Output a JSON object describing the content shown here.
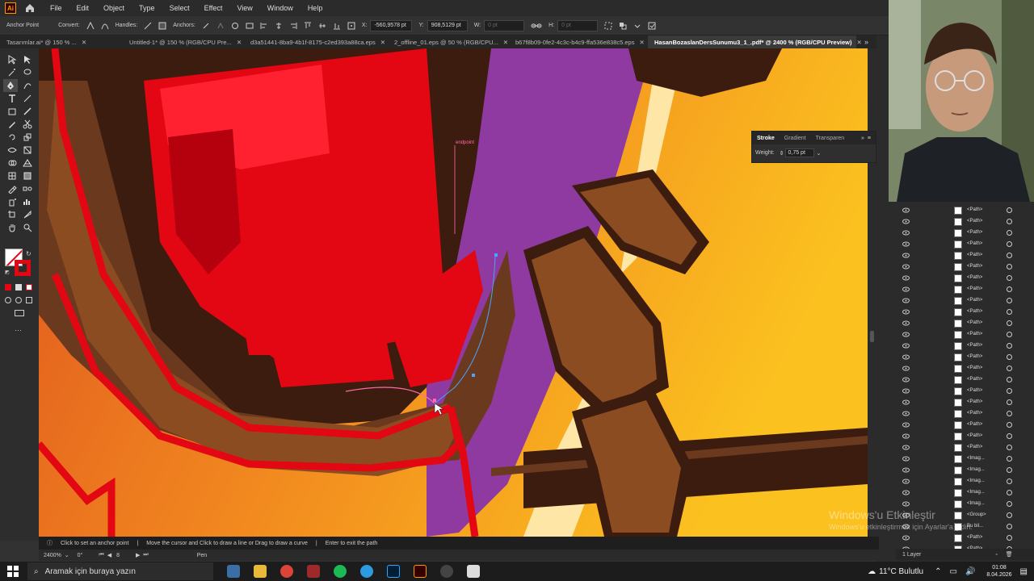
{
  "menu": {
    "app_logo": "Ai",
    "items": [
      "File",
      "Edit",
      "Object",
      "Type",
      "Select",
      "Effect",
      "View",
      "Window",
      "Help"
    ]
  },
  "control_bar": {
    "anchor_point_label": "Anchor Point",
    "convert_label": "Convert:",
    "handles_label": "Handles:",
    "anchors_label": "Anchors:",
    "x_label": "X:",
    "x_value": "-560,9578 pt",
    "y_label": "Y:",
    "y_value": "908,5129 pt",
    "w_label": "W:",
    "w_value": "0 pt",
    "h_label": "H:",
    "h_value": "0 pt"
  },
  "tabs": [
    {
      "label": "Tasarımlar.ai* @ 150 % ...",
      "active": false
    },
    {
      "label": "Untitled-1* @ 150 % (RGB/CPU Pre...",
      "active": false
    },
    {
      "label": "d3a51441-8ba9-4b1f-8175-c2ed393a88ca.eps",
      "active": false
    },
    {
      "label": "2_offline_01.eps @ 50 % (RGB/CPU...",
      "active": false
    },
    {
      "label": "b67f8b09-0fe2-4c3c-b4c9-ffa536e838c5.eps",
      "active": false
    },
    {
      "label": "HasanBozaslanDersSunumu3_1_.pdf* @ 2400 % (RGB/CPU Preview)",
      "active": true
    }
  ],
  "canvas": {
    "tooltip_text": "endpoint"
  },
  "stroke_panel": {
    "tabs": [
      "Stroke",
      "Gradient",
      "Transparen"
    ],
    "weight_label": "Weight:",
    "weight_value": "0,75 pt"
  },
  "status": {
    "hints": [
      "Click to set an anchor point",
      "Move the cursor and Click to draw a line or Drag to draw a curve",
      "Enter to exit the path"
    ],
    "zoom": "2400%",
    "rotation": "0°",
    "artboard": "8",
    "tool_name": "Pen"
  },
  "layers": {
    "rows": [
      "<Path>",
      "<Path>",
      "<Path>",
      "<Path>",
      "<Path>",
      "<Path>",
      "<Path>",
      "<Path>",
      "<Path>",
      "<Path>",
      "<Path>",
      "<Path>",
      "<Path>",
      "<Path>",
      "<Path>",
      "<Path>",
      "<Path>",
      "<Path>",
      "<Path>",
      "<Path>",
      "<Path>",
      "<Path>",
      "<Imag...",
      "<Imag...",
      "<Imag...",
      "<Imag...",
      "<Imag...",
      "<Group>",
      "Bu bil...",
      "<Path>",
      "<Path>"
    ],
    "footer": "1 Layer"
  },
  "watermark": {
    "title": "Windows'u Etkinleştir",
    "subtitle": "Windows'u etkinleştirmek için Ayarlar'a gidin."
  },
  "taskbar": {
    "search_placeholder": "Aramak için buraya yazın",
    "weather": "11°C  Bulutlu",
    "time": "01:08",
    "date": "8.04.2026"
  },
  "colors": {
    "accent_red": "#e30613",
    "dark_red": "#b5000d",
    "brown": "#8c4c22",
    "dark_brown": "#3d1c10",
    "purple": "#8e3aa0",
    "orange": "#f08a1c"
  }
}
